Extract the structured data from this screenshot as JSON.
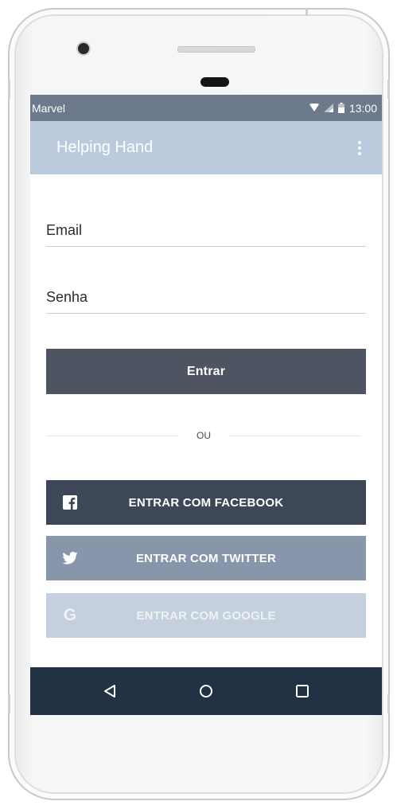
{
  "status_bar": {
    "carrier": "Marvel",
    "time": "13:00",
    "icons": [
      "wifi-icon",
      "signal-icon",
      "battery-icon"
    ]
  },
  "app_bar": {
    "title": "Helping Hand",
    "menu_icon": "more-vert-icon"
  },
  "login_form": {
    "email_placeholder": "Email",
    "password_placeholder": "Senha",
    "submit_label": "Entrar",
    "or_text": "OU"
  },
  "social_login": {
    "facebook_label": "ENTRAR COM FACEBOOK",
    "twitter_label": "ENTRAR COM TWITTER",
    "google_label": "ENTRAR COM GOOGLE",
    "google_icon_letter": "G"
  },
  "nav_bar": {
    "items": [
      "back-icon",
      "home-icon",
      "recents-icon"
    ]
  },
  "colors": {
    "status_bar": "#6c7a8b",
    "app_bar": "#bccadd",
    "login_button": "#4e5461",
    "facebook_button": "#3d4757",
    "twitter_button": "#8796aa",
    "google_button": "#c5d0de",
    "nav_bar": "#223244"
  }
}
